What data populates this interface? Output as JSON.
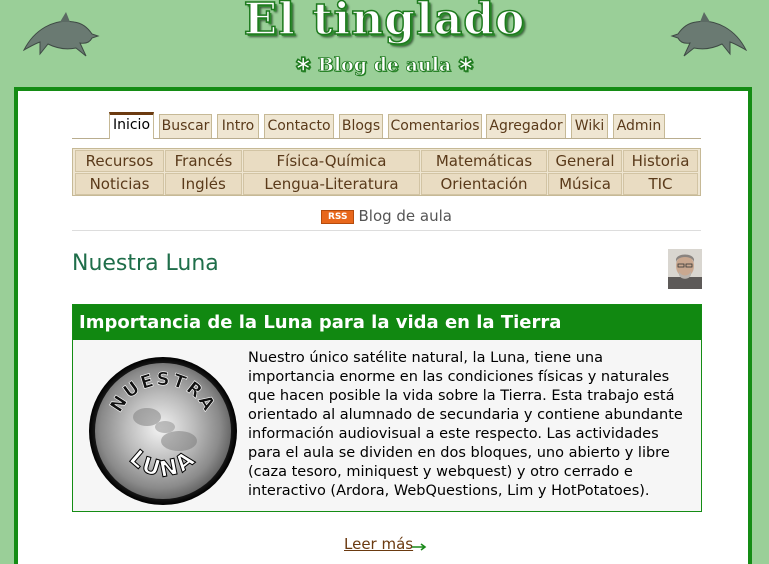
{
  "header": {
    "title": "El tinglado",
    "subtitle": "✱ Blog de aula ✱"
  },
  "tabs": [
    {
      "label": "Inicio",
      "active": true
    },
    {
      "label": "Buscar"
    },
    {
      "label": "Intro"
    },
    {
      "label": "Contacto"
    },
    {
      "label": "Blogs"
    },
    {
      "label": "Comentarios"
    },
    {
      "label": "Agregador"
    },
    {
      "label": "Wiki"
    },
    {
      "label": "Admin"
    }
  ],
  "categories": {
    "row1": [
      "Recursos",
      "Francés",
      "Física-Química",
      "Matemáticas",
      "General",
      "Historia"
    ],
    "row2": [
      "Noticias",
      "Inglés",
      "Lengua-Literatura",
      "Orientación",
      "Música",
      "TIC"
    ]
  },
  "feed": {
    "badge": "RSS",
    "label": "Blog de aula"
  },
  "blog": {
    "title": "Nuestra Luna"
  },
  "post": {
    "title": "Importancia de la Luna para la vida en la Tierra",
    "image_text_top": "NUESTRA",
    "image_text_bottom": "LUNA",
    "body": "Nuestro único satélite natural, la Luna, tiene una importancia enorme en las condiciones físicas y naturales que hacen posible la vida sobre la Tierra. Esta trabajo está orientado al alumnado de secundaria y contiene abundante información audiovisual a este respecto. Las actividades para el aula se dividen en dos bloques, uno abierto y libre (caza tesoro, miniquest y webquest) y otro cerrado e interactivo (Ardora, WebQuestions, Lim y HotPotatoes).",
    "read_more": "Leer más"
  },
  "colors": {
    "background": "#9acf98",
    "frame": "#148c14",
    "post_header": "#118811",
    "tab_bg": "#efe6d2",
    "link": "#6b3a10"
  }
}
